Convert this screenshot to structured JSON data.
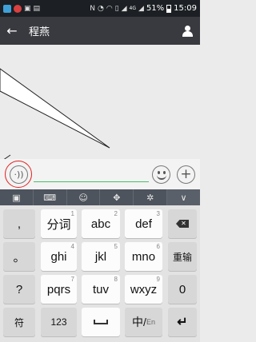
{
  "status_bar": {
    "battery_percent": "51%",
    "time": "15:09",
    "network": "4G",
    "icons": [
      "notification-icon",
      "notification-icon",
      "gallery-icon",
      "image-icon",
      "nfc-icon",
      "alarm-icon",
      "wifi-icon",
      "vibrate-icon",
      "signal-icon",
      "battery-icon"
    ]
  },
  "title_bar": {
    "back_icon": "←",
    "title": "程燕",
    "person_icon": "person-icon"
  },
  "input_bar": {
    "voice_glyph": "·))",
    "plus_glyph": "+"
  },
  "toolbar": {
    "items": [
      "menu-icon",
      "keyboard-icon",
      "emoji-icon",
      "cursor-move-icon",
      "settings-icon",
      "collapse-icon"
    ],
    "glyphs": [
      "▣",
      "⌨",
      "☺",
      "✥",
      "✲",
      "∨"
    ]
  },
  "keyboard": {
    "rows": [
      [
        {
          "label": ",",
          "sup": ""
        },
        {
          "label": "分词",
          "sup": "1"
        },
        {
          "label": "abc",
          "sup": "2"
        },
        {
          "label": "def",
          "sup": "3"
        },
        {
          "label": "",
          "sup": "",
          "icon": "backspace-icon"
        }
      ],
      [
        {
          "label": "。",
          "sup": ""
        },
        {
          "label": "ghi",
          "sup": "4"
        },
        {
          "label": "jkl",
          "sup": "5"
        },
        {
          "label": "mno",
          "sup": "6"
        },
        {
          "label": "重输",
          "sup": ""
        }
      ],
      [
        {
          "label": "?",
          "sup": ""
        },
        {
          "label": "pqrs",
          "sup": "7"
        },
        {
          "label": "tuv",
          "sup": "8"
        },
        {
          "label": "wxyz",
          "sup": "9"
        },
        {
          "label": "0",
          "sup": ""
        }
      ],
      [
        {
          "label": "符",
          "sup": ""
        },
        {
          "label": "123",
          "sup": ""
        },
        {
          "label": "",
          "sup": "",
          "icon": "space-icon"
        },
        {
          "label": "中/En",
          "sup": ""
        },
        {
          "label": "",
          "sup": "",
          "icon": "enter-icon"
        }
      ]
    ],
    "backspace_glyph": "✕",
    "enter_glyph": "↵",
    "zh_label": "中/",
    "en_label": "En"
  },
  "colors": {
    "status_bar": "#1c1f23",
    "title_bar": "#393a3f",
    "chat_bg": "#ebebeb",
    "toolbar": "#4e545d",
    "keyboard_bg": "#e3e3e3",
    "highlight_circle": "#e02020",
    "input_underline": "#45c06a"
  }
}
